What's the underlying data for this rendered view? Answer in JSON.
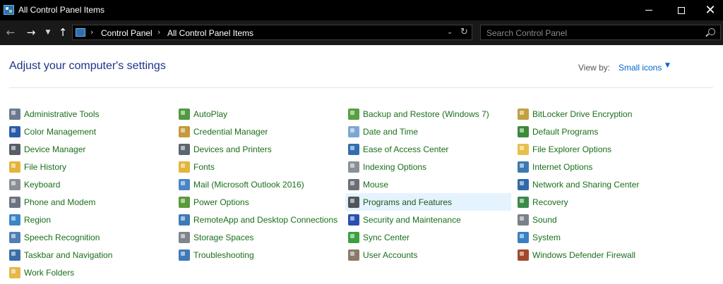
{
  "window": {
    "title": "All Control Panel Items"
  },
  "address": {
    "breadcrumbs": [
      "Control Panel",
      "All Control Panel Items"
    ]
  },
  "search": {
    "placeholder": "Search Control Panel"
  },
  "header": {
    "title": "Adjust your computer's settings",
    "view_by_label": "View by:",
    "view_by_value": "Small icons"
  },
  "columns": [
    [
      {
        "label": "Administrative Tools",
        "icon": "admin-tools-icon",
        "color": "#6b7b8c"
      },
      {
        "label": "Color Management",
        "icon": "color-management-icon",
        "color": "#2a5caa"
      },
      {
        "label": "Device Manager",
        "icon": "device-manager-icon",
        "color": "#555d66"
      },
      {
        "label": "File History",
        "icon": "file-history-icon",
        "color": "#e2b53a"
      },
      {
        "label": "Keyboard",
        "icon": "keyboard-icon",
        "color": "#8a8f96"
      },
      {
        "label": "Phone and Modem",
        "icon": "phone-modem-icon",
        "color": "#6c7480"
      },
      {
        "label": "Region",
        "icon": "region-icon",
        "color": "#3a86c8"
      },
      {
        "label": "Speech Recognition",
        "icon": "microphone-icon",
        "color": "#4f7fb8"
      },
      {
        "label": "Taskbar and Navigation",
        "icon": "taskbar-icon",
        "color": "#3b6ea8"
      },
      {
        "label": "Work Folders",
        "icon": "work-folders-icon",
        "color": "#e6b84a"
      }
    ],
    [
      {
        "label": "AutoPlay",
        "icon": "autoplay-icon",
        "color": "#4f9a3e"
      },
      {
        "label": "Credential Manager",
        "icon": "credential-manager-icon",
        "color": "#c49a3a"
      },
      {
        "label": "Devices and Printers",
        "icon": "printer-icon",
        "color": "#5b6570"
      },
      {
        "label": "Fonts",
        "icon": "fonts-icon",
        "color": "#e2b53a"
      },
      {
        "label": "Mail (Microsoft Outlook 2016)",
        "icon": "mail-icon",
        "color": "#4a86c5"
      },
      {
        "label": "Power Options",
        "icon": "power-options-icon",
        "color": "#5a9a3a"
      },
      {
        "label": "RemoteApp and Desktop Connections",
        "icon": "remote-desktop-icon",
        "color": "#3f7ab8"
      },
      {
        "label": "Storage Spaces",
        "icon": "storage-spaces-icon",
        "color": "#7d858d"
      },
      {
        "label": "Troubleshooting",
        "icon": "troubleshooting-icon",
        "color": "#3f7ab8"
      }
    ],
    [
      {
        "label": "Backup and Restore (Windows 7)",
        "icon": "backup-restore-icon",
        "color": "#5aa040"
      },
      {
        "label": "Date and Time",
        "icon": "date-time-icon",
        "color": "#7ea6d2"
      },
      {
        "label": "Ease of Access Center",
        "icon": "ease-of-access-icon",
        "color": "#2f6fb0"
      },
      {
        "label": "Indexing Options",
        "icon": "indexing-options-icon",
        "color": "#8a9098"
      },
      {
        "label": "Mouse",
        "icon": "mouse-icon",
        "color": "#6a6f76"
      },
      {
        "label": "Programs and Features",
        "icon": "programs-features-icon",
        "color": "#4d545c"
      },
      {
        "label": "Security and Maintenance",
        "icon": "flag-icon",
        "color": "#2a4fb0"
      },
      {
        "label": "Sync Center",
        "icon": "sync-center-icon",
        "color": "#3aa040"
      },
      {
        "label": "User Accounts",
        "icon": "user-accounts-icon",
        "color": "#8a7a6a"
      }
    ],
    [
      {
        "label": "BitLocker Drive Encryption",
        "icon": "bitlocker-icon",
        "color": "#c0a040"
      },
      {
        "label": "Default Programs",
        "icon": "default-programs-icon",
        "color": "#3a8a3a"
      },
      {
        "label": "File Explorer Options",
        "icon": "folder-options-icon",
        "color": "#e6c04a"
      },
      {
        "label": "Internet Options",
        "icon": "internet-options-icon",
        "color": "#3a7ab0"
      },
      {
        "label": "Network and Sharing Center",
        "icon": "network-icon",
        "color": "#2f6aa8"
      },
      {
        "label": "Recovery",
        "icon": "recovery-icon",
        "color": "#3a8a4a"
      },
      {
        "label": "Sound",
        "icon": "sound-icon",
        "color": "#7a8088"
      },
      {
        "label": "System",
        "icon": "system-icon",
        "color": "#3a7fc0"
      },
      {
        "label": "Windows Defender Firewall",
        "icon": "firewall-icon",
        "color": "#a04a2a"
      }
    ]
  ],
  "selected_item": "Programs and Features"
}
